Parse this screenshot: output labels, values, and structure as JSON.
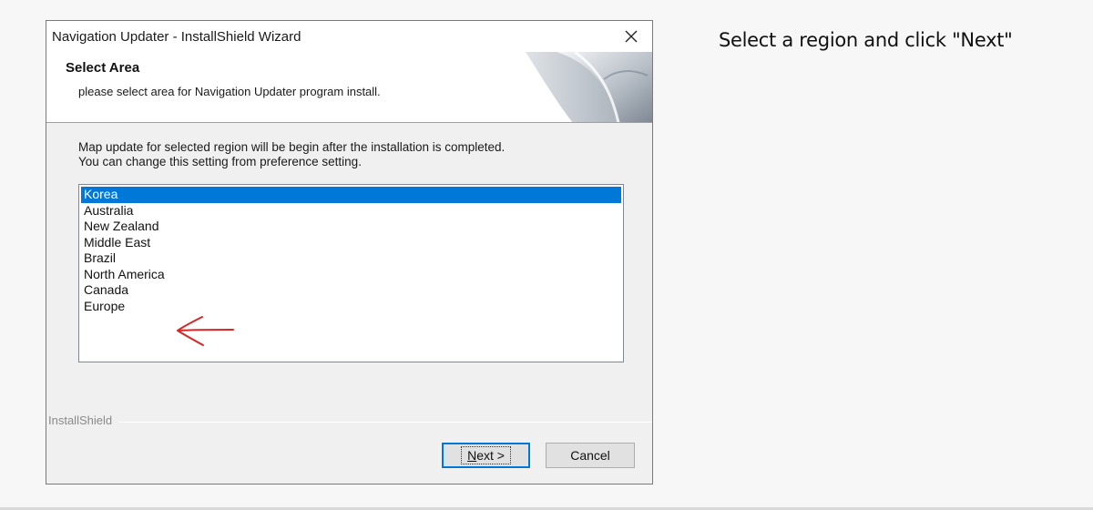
{
  "caption": "Select a region and click \"Next\"",
  "window": {
    "title": "Navigation Updater - InstallShield Wizard",
    "close_icon": "close-icon"
  },
  "header": {
    "title": "Select Area",
    "subtitle": "please select area for Navigation Updater program install."
  },
  "body": {
    "line1": "Map update for selected region will be begin after the installation is completed.",
    "line2": "You can change this setting from preference setting."
  },
  "regions": {
    "items": [
      "Korea",
      "Australia",
      "New Zealand",
      "Middle East",
      "Brazil",
      "North America",
      "Canada",
      "Europe"
    ],
    "selected": "Korea"
  },
  "annotation": {
    "icon": "red-arrow-icon",
    "color": "#d62828",
    "target": "Europe"
  },
  "footer": {
    "brand": "InstallShield",
    "next_accel": "N",
    "next_rest": "ext >",
    "cancel": "Cancel"
  },
  "colors": {
    "selection": "#0078d7",
    "window_bg": "#f0f0f0",
    "focus_border": "#0078d7"
  }
}
